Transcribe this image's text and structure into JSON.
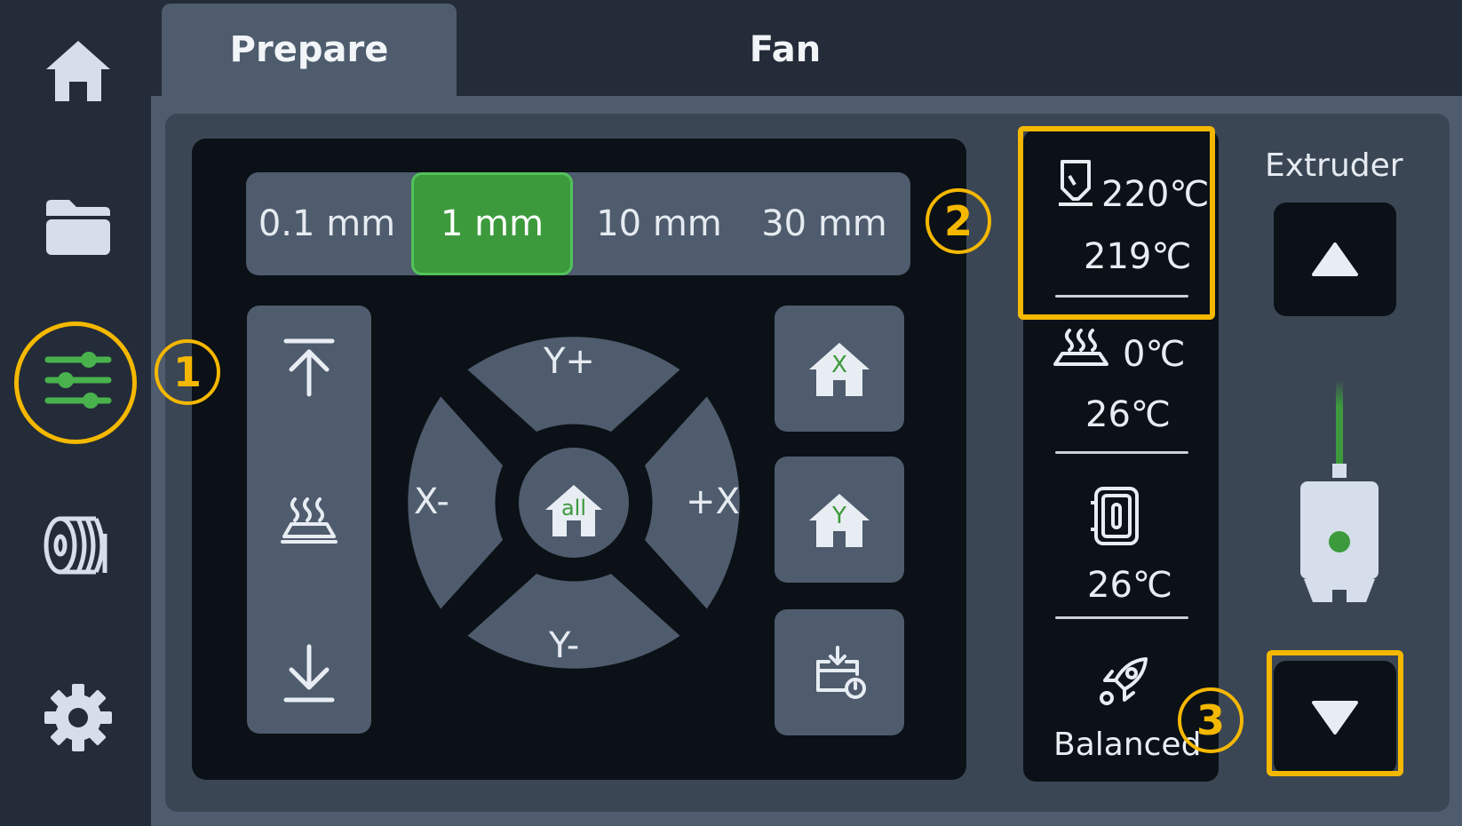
{
  "tabs": [
    "Prepare",
    "Fan"
  ],
  "steps": [
    "0.1 mm",
    "1 mm",
    "10 mm",
    "30 mm"
  ],
  "dpad": {
    "y_plus": "Y+",
    "y_minus": "Y-",
    "x_minus": "X-",
    "x_plus": "+X",
    "home_all": "all"
  },
  "home_x": "X",
  "home_y": "Y",
  "nozzle": {
    "target": "220℃",
    "current": "219℃"
  },
  "bed": {
    "target": "0℃",
    "current": "26℃"
  },
  "chamber": {
    "current": "26℃"
  },
  "speed_mode": "Balanced",
  "extruder_label": "Extruder",
  "annotations": [
    "1",
    "2",
    "3"
  ],
  "colors": {
    "accent_green": "#3c9a3c",
    "highlight": "#f5b800"
  },
  "icons": {
    "sidebar": [
      "home-icon",
      "folder-icon",
      "sliders-icon",
      "filament-spool-icon",
      "gear-icon"
    ],
    "z_column": [
      "z-up-icon",
      "heated-bed-icon",
      "z-down-icon"
    ],
    "home_buttons": [
      "home-x-icon",
      "home-y-icon",
      "bed-calibration-icon"
    ]
  }
}
